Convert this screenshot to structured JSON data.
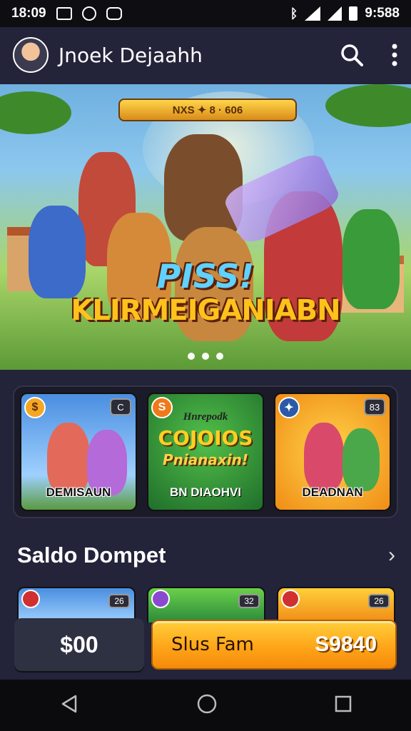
{
  "status_bar": {
    "time": "18:09",
    "clock_right": "9:588"
  },
  "app_bar": {
    "title": "Jnoek Dejaahh"
  },
  "hero": {
    "banner_chip": "NXS  ✦  8 · 606",
    "title_line1": "PISS!",
    "title_line2": "KLIRMEIGANIABN"
  },
  "cards": [
    {
      "badge_left": "$",
      "badge_right": "C",
      "label": "DEMISAUN",
      "bg": "#4a8ee0"
    },
    {
      "badge_left": "S",
      "badge_right": "",
      "label": "BN DIAOHVI",
      "promo_small": "Hnrepodk",
      "promo_big": "COJOIOS",
      "promo_sub": "Pnianaxin!",
      "bg": "#2b9a3c"
    },
    {
      "badge_left": "✦",
      "badge_right": "83",
      "label": "DEADNAN",
      "bg": "#f5a623"
    }
  ],
  "section": {
    "title": "Saldo Dompet",
    "more": "›"
  },
  "mini_cards": [
    {
      "badge_right": "26"
    },
    {
      "badge_right": "32"
    },
    {
      "badge_right": "26"
    }
  ],
  "footer": {
    "balance": "$00",
    "cta_label": "Slus Fam",
    "cta_amount": "S9840"
  }
}
